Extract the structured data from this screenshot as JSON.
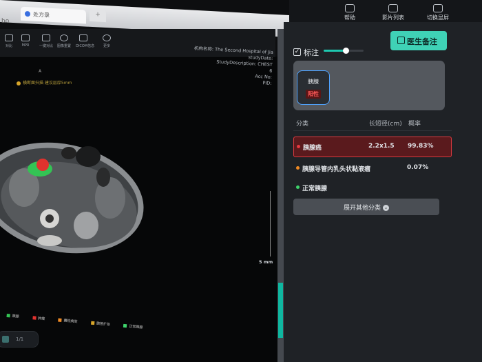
{
  "browser": {
    "tab_title": "处方录",
    "tab_add": "+",
    "address": "bo"
  },
  "toolbar": {
    "tools": [
      {
        "label": "对比"
      },
      {
        "label": "MPR"
      },
      {
        "label": "一键对比"
      },
      {
        "label": "图像重置"
      },
      {
        "label": "DICOM信息"
      },
      {
        "label": "更多"
      }
    ]
  },
  "top_nav": {
    "help": "帮助",
    "film_list": "影片列表",
    "switch_screen": "切换显屏"
  },
  "viewer": {
    "meta": [
      "机构名称: The Second Hospital of Jia",
      "studyDate:",
      "StudyDescription: CHEST",
      "6",
      "Acc No:",
      "PID:"
    ],
    "orientation": "A",
    "warning": "横断面扫描 建议层厚5mm",
    "scale": "5 mm",
    "legend": [
      "胰腺",
      "肿瘤",
      "囊性病变",
      "胰管扩张",
      "正常胰腺"
    ],
    "bottom_label": "1/1"
  },
  "panel": {
    "annotate_label": "标注",
    "annotate_checked": "✓",
    "opacity": 0.55,
    "doctor_note_button": "医生备注",
    "organ": {
      "name": "胰腺",
      "badge": "阳性"
    },
    "columns": {
      "category": "分类",
      "size": "长短径(cm)",
      "probability": "概率"
    },
    "rows": [
      {
        "name": "胰腺癌",
        "size": "2.2x1.5",
        "probability": "99.83%",
        "color": "#e5393f",
        "selected": true
      },
      {
        "name": "胰腺导管内乳头状黏液瘤",
        "size": "-",
        "probability": "0.07%",
        "color": "#f08a24",
        "selected": false
      },
      {
        "name": "正常胰腺",
        "size": "",
        "probability": "",
        "color": "#3ed36b",
        "selected": false
      }
    ],
    "expand_label": "展开其他分类",
    "expand_icon": "⌄"
  },
  "colors": {
    "accent": "#3fd2b6",
    "danger": "#e0393f"
  }
}
